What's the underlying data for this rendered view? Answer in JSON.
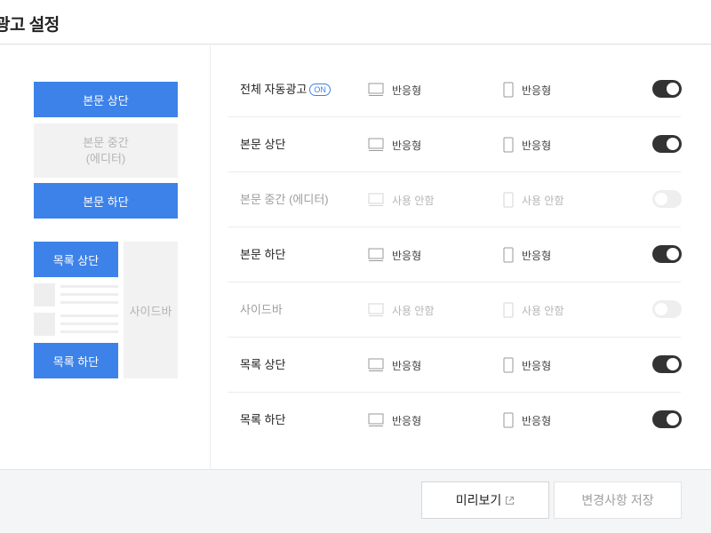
{
  "header": {
    "title": "광고 설정"
  },
  "preview": {
    "body_top": "본문 상단",
    "body_middle_line1": "본문 중간",
    "body_middle_line2": "(에디터)",
    "body_bottom": "본문 하단",
    "list_top": "목록 상단",
    "list_bottom": "목록 하단",
    "sidebar": "사이드바"
  },
  "rows": [
    {
      "label": "전체 자동광고",
      "badge": "ON",
      "pc": "반응형",
      "mobile": "반응형",
      "enabled": true
    },
    {
      "label": "본문 상단",
      "pc": "반응형",
      "mobile": "반응형",
      "enabled": true
    },
    {
      "label": "본문 중간 (에디터)",
      "pc": "사용 안함",
      "mobile": "사용 안함",
      "enabled": false
    },
    {
      "label": "본문 하단",
      "pc": "반응형",
      "mobile": "반응형",
      "enabled": true
    },
    {
      "label": "사이드바",
      "pc": "사용 안함",
      "mobile": "사용 안함",
      "enabled": false
    },
    {
      "label": "목록 상단",
      "pc": "반응형",
      "mobile": "반응형",
      "enabled": true
    },
    {
      "label": "목록 하단",
      "pc": "반응형",
      "mobile": "반응형",
      "enabled": true
    }
  ],
  "footer": {
    "preview_label": "미리보기",
    "save_label": "변경사항 저장"
  },
  "colors": {
    "accent": "#3d82e8",
    "toggle_on": "#333333",
    "toggle_off": "#eeeeee"
  },
  "icons": {
    "pc": "monitor-icon",
    "mobile": "phone-icon",
    "preview": "external-link-icon"
  }
}
